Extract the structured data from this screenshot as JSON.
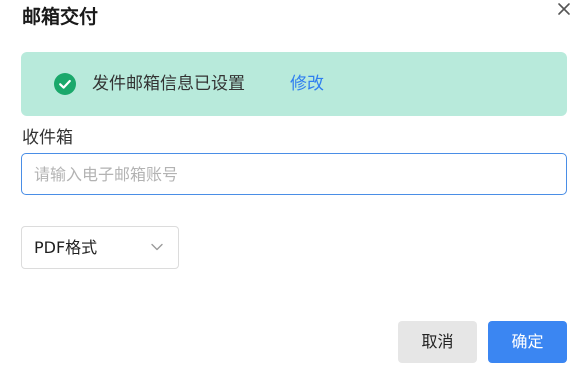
{
  "dialog": {
    "title": "邮箱交付",
    "close_icon": "close-icon"
  },
  "notice": {
    "icon": "check-circle-icon",
    "message": "发件邮箱信息已设置",
    "edit_link": "修改",
    "background_color": "#b8eadb",
    "icon_color": "#1aa86b",
    "link_color": "#2f7ef0"
  },
  "recipient": {
    "label": "收件箱",
    "placeholder": "请输入电子邮箱账号",
    "value": ""
  },
  "format": {
    "selected": "PDF格式",
    "icon": "chevron-down-icon"
  },
  "actions": {
    "cancel_label": "取消",
    "confirm_label": "确定",
    "primary_color": "#3b86f2"
  }
}
